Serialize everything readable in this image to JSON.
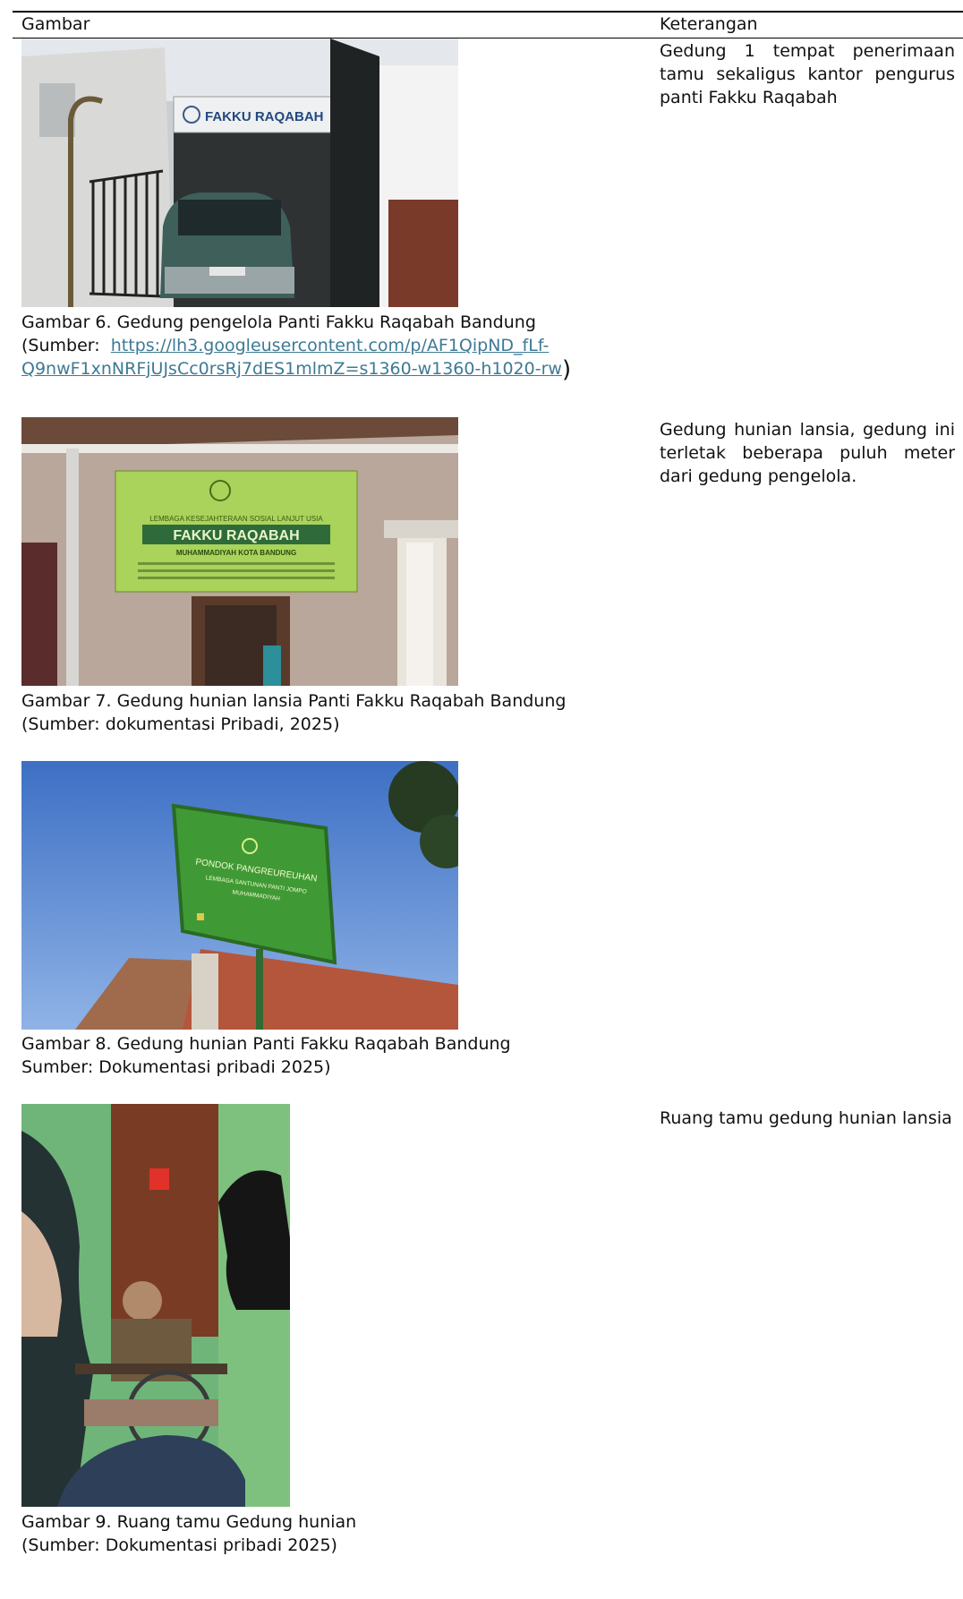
{
  "table": {
    "headers": {
      "image": "Gambar",
      "description": "Keterangan"
    },
    "rows": [
      {
        "caption": "Gambar 6. Gedung pengelola Panti Fakku Raqabah Bandung",
        "source_prefix": "(Sumber:",
        "source_link_line1": "https://lh3.googleusercontent.com/p/AF1QipND_fLf-",
        "source_link_line2": "Q9nwF1xnNRFjUJsCc0rsRj7dES1mlmZ=s1360-w1360-h1020-rw",
        "source_close": ")",
        "description": "Gedung 1 tempat penerimaan tamu sekaligus kantor pengurus panti Fakku Raqabah",
        "photo_signs": [
          "FAKKU RAQABAH"
        ]
      },
      {
        "caption": "Gambar 7. Gedung hunian lansia Panti Fakku Raqabah Bandung",
        "source": "(Sumber: dokumentasi Pribadi, 2025)",
        "description": "Gedung hunian lansia, gedung ini terletak beberapa puluh meter dari gedung pengelola.",
        "photo_signs": [
          "LEMBAGA KESEJAHTERAAN SOSIAL LANJUT USIA",
          "FAKKU RAQABAH",
          "MUHAMMADIYAH KOTA BANDUNG"
        ]
      },
      {
        "caption": "Gambar 8. Gedung hunian Panti Fakku Raqabah Bandung",
        "source": "Sumber: Dokumentasi pribadi 2025)",
        "description": "",
        "photo_signs": [
          "PONDOK PANGREUREUHAN",
          "LEMBAGA SANTUNAN PANTI JOMPO",
          "MUHAMMADIYAH"
        ]
      },
      {
        "caption": "Gambar 9. Ruang tamu Gedung hunian",
        "source": "(Sumber: Dokumentasi pribadi 2025)",
        "description": "Ruang tamu gedung hunian lansia",
        "photo_signs": []
      }
    ]
  },
  "colors": {
    "rule": "#000000",
    "link": "#3d7a95",
    "sign_green": "#9ccc4a"
  }
}
